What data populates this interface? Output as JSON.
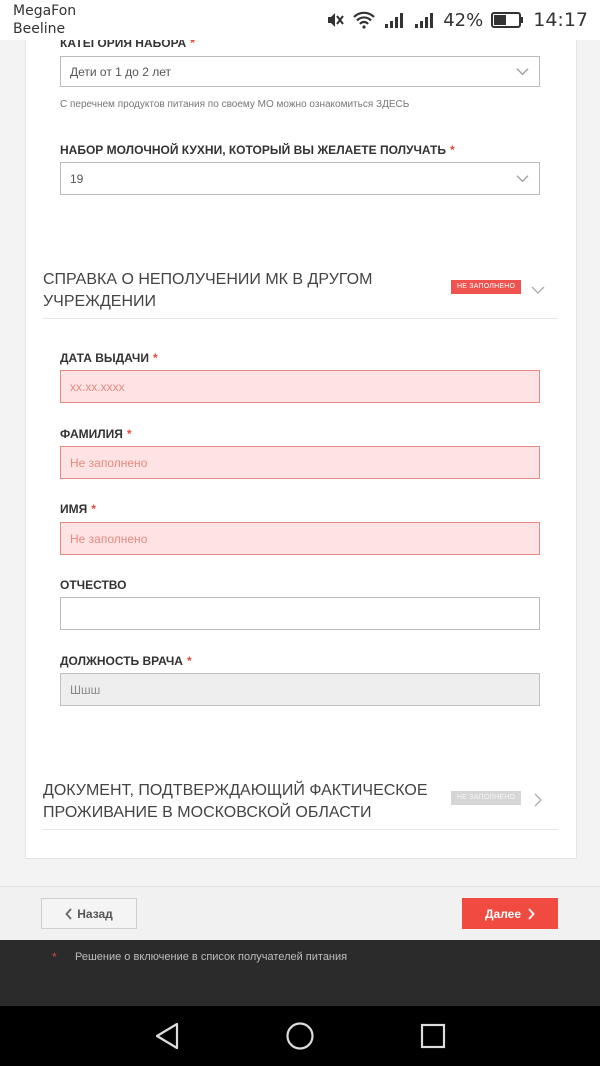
{
  "statusbar": {
    "carrier1": "MegaFon",
    "carrier2": "Beeline",
    "battery_pct": "42%",
    "time": "14:17",
    "icons": [
      "mute-icon",
      "wifi-icon",
      "signal-icon",
      "signal-icon",
      "battery-icon"
    ]
  },
  "form": {
    "set_category": {
      "label": "КАТЕГОРИЯ НАБОРА",
      "required": "*",
      "value": "Дети от 1 до 2 лет"
    },
    "hint": "С перечнем продуктов питания по своему МО можно ознакомиться ЗДЕСЬ",
    "kitchen_set": {
      "label": "НАБОР МОЛОЧНОЙ КУХНИ, КОТОРЫЙ ВЫ ЖЕЛАЕТЕ ПОЛУЧАТЬ",
      "required": "*",
      "value": "19"
    },
    "section_certificate": {
      "title": "СПРАВКА О НЕПОЛУЧЕНИИ МК В ДРУГОМ УЧРЕЖДЕНИИ",
      "badge": "НЕ ЗАПОЛНЕНО",
      "badge_color": "#ef5350"
    },
    "issue_date": {
      "label": "ДАТА ВЫДАЧИ",
      "required": "*",
      "placeholder": "xx.xx.xxxx"
    },
    "last_name": {
      "label": "ФАМИЛИЯ",
      "required": "*",
      "placeholder": "Не заполнено"
    },
    "first_name": {
      "label": "ИМЯ",
      "required": "*",
      "placeholder": "Не заполнено"
    },
    "patronymic": {
      "label": "ОТЧЕСТВО",
      "value": ""
    },
    "doctor_position": {
      "label": "ДОЛЖНОСТЬ ВРАЧА",
      "required": "*",
      "value": "Шшш"
    },
    "section_residence": {
      "title": "ДОКУМЕНТ, ПОДТВЕРЖДАЮЩИЙ ФАКТИЧЕСКОЕ ПРОЖИВАНИЕ В МОСКОВСКОЙ ОБЛАСТИ",
      "badge": "НЕ ЗАПОЛНЕНО",
      "badge_color": "#d6d6d6"
    }
  },
  "footer": {
    "back_label": "Назад",
    "next_label": "Далее",
    "accent": "#f04a41"
  },
  "behind": {
    "bullet": "*",
    "text": "Решение о включение в список получателей питания"
  },
  "navbar": {
    "icons": [
      "back-icon",
      "home-icon",
      "recents-icon"
    ]
  }
}
